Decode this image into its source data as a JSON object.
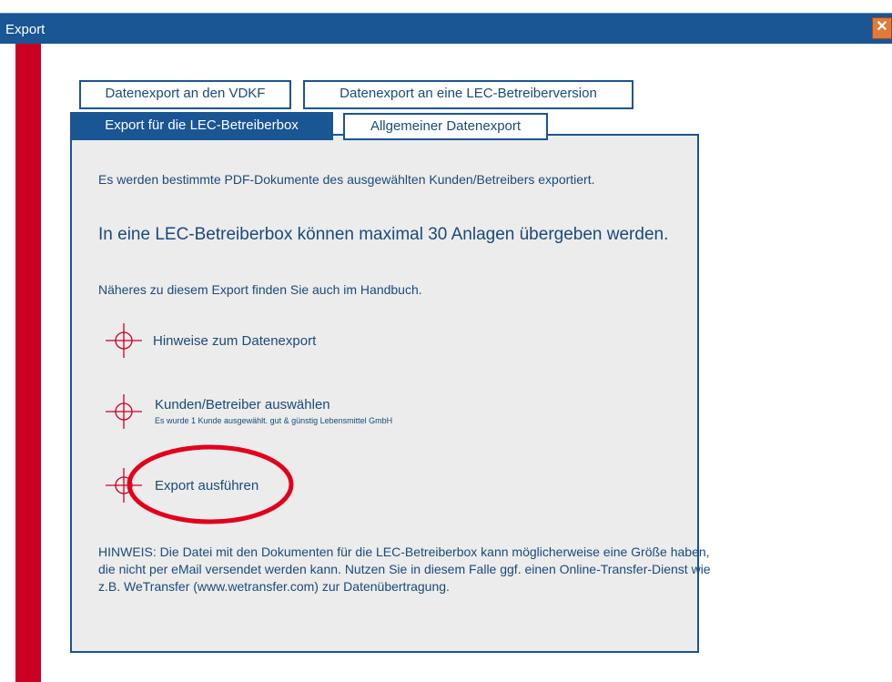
{
  "window": {
    "title": "Export",
    "close_symbol": "✕"
  },
  "tabs_row1": [
    {
      "label": "Datenexport an den VDKF"
    },
    {
      "label": "Datenexport an eine LEC-Betreiberversion"
    }
  ],
  "tabs_row2": [
    {
      "label": "Export für die LEC-Betreiberbox",
      "active": true
    },
    {
      "label": "Allgemeiner Datenexport",
      "active": false
    }
  ],
  "panel": {
    "intro": "Es werden bestimmte PDF-Dokumente des ausgewählten Kunden/Betreibers exportiert.",
    "headline": "In eine LEC-Betreiberbox können maximal 30 Anlagen übergeben werden.",
    "handbook_note": "Näheres zu diesem Export finden Sie auch im Handbuch.",
    "links": [
      {
        "label": "Hinweise zum Datenexport",
        "icon": "crosshair-icon"
      },
      {
        "label": "Kunden/Betreiber auswählen",
        "sublabel": "Es wurde 1 Kunde ausgewählt. gut & günstig Lebensmittel GmbH",
        "icon": "crosshair-icon"
      },
      {
        "label": "Export ausführen",
        "icon": "crosshair-icon"
      }
    ],
    "hint_lines": [
      "HINWEIS: Die Datei mit den Dokumenten für die LEC-Betreiberbox kann möglicherweise eine Größe haben,",
      "die nicht per eMail versendet werden kann. Nutzen Sie in diesem Falle ggf. einen Online-Transfer-Dienst wie",
      "z.B. WeTransfer (www.wetransfer.com) zur Datenübertragung."
    ]
  },
  "colors": {
    "titlebar": "#1a5594",
    "accent_red": "#cc0022",
    "annotation_red": "#e3001b",
    "text_blue": "#1a4a7a",
    "panel_bg": "#ececec"
  }
}
